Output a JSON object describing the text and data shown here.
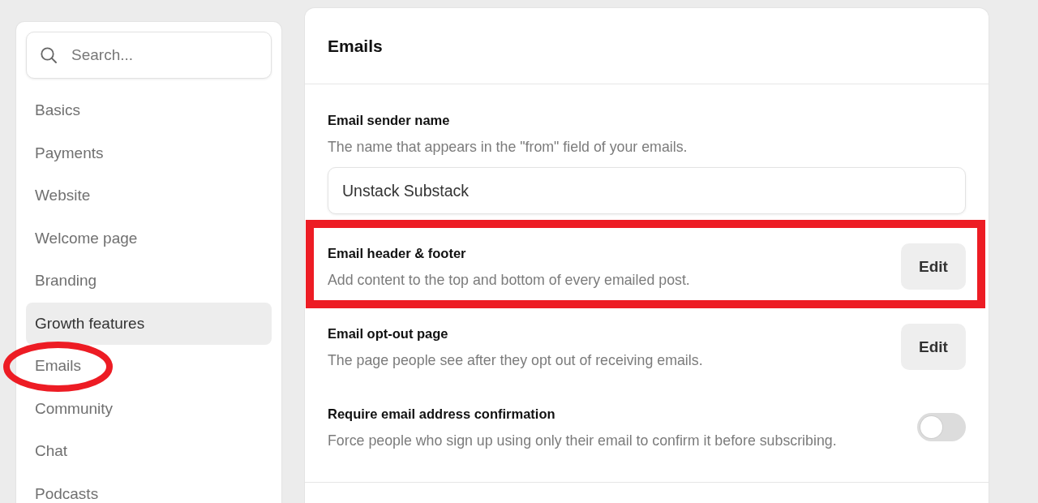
{
  "sidebar": {
    "search": {
      "placeholder": "Search..."
    },
    "items": [
      {
        "label": "Basics",
        "selected": false,
        "circled": false
      },
      {
        "label": "Payments",
        "selected": false,
        "circled": false
      },
      {
        "label": "Website",
        "selected": false,
        "circled": false
      },
      {
        "label": "Welcome page",
        "selected": false,
        "circled": false
      },
      {
        "label": "Branding",
        "selected": false,
        "circled": false
      },
      {
        "label": "Growth features",
        "selected": true,
        "circled": false
      },
      {
        "label": "Emails",
        "selected": false,
        "circled": true
      },
      {
        "label": "Community",
        "selected": false,
        "circled": false
      },
      {
        "label": "Chat",
        "selected": false,
        "circled": false
      },
      {
        "label": "Podcasts",
        "selected": false,
        "circled": false
      }
    ]
  },
  "panel": {
    "title": "Emails",
    "settings": [
      {
        "kind": "text_field",
        "title": "Email sender name",
        "description": "The name that appears in the \"from\" field of your emails.",
        "value": "Unstack Substack",
        "highlighted": false
      },
      {
        "kind": "button",
        "title": "Email header & footer",
        "description": "Add content to the top and bottom of every emailed post.",
        "button": "Edit",
        "highlighted": true
      },
      {
        "kind": "button",
        "title": "Email opt-out page",
        "description": "The page people see after they opt out of receiving emails.",
        "button": "Edit",
        "highlighted": false
      },
      {
        "kind": "toggle",
        "title": "Require email address confirmation",
        "description": "Force people who sign up using only their email to confirm it before subscribing.",
        "on": false,
        "highlighted": false
      }
    ]
  }
}
